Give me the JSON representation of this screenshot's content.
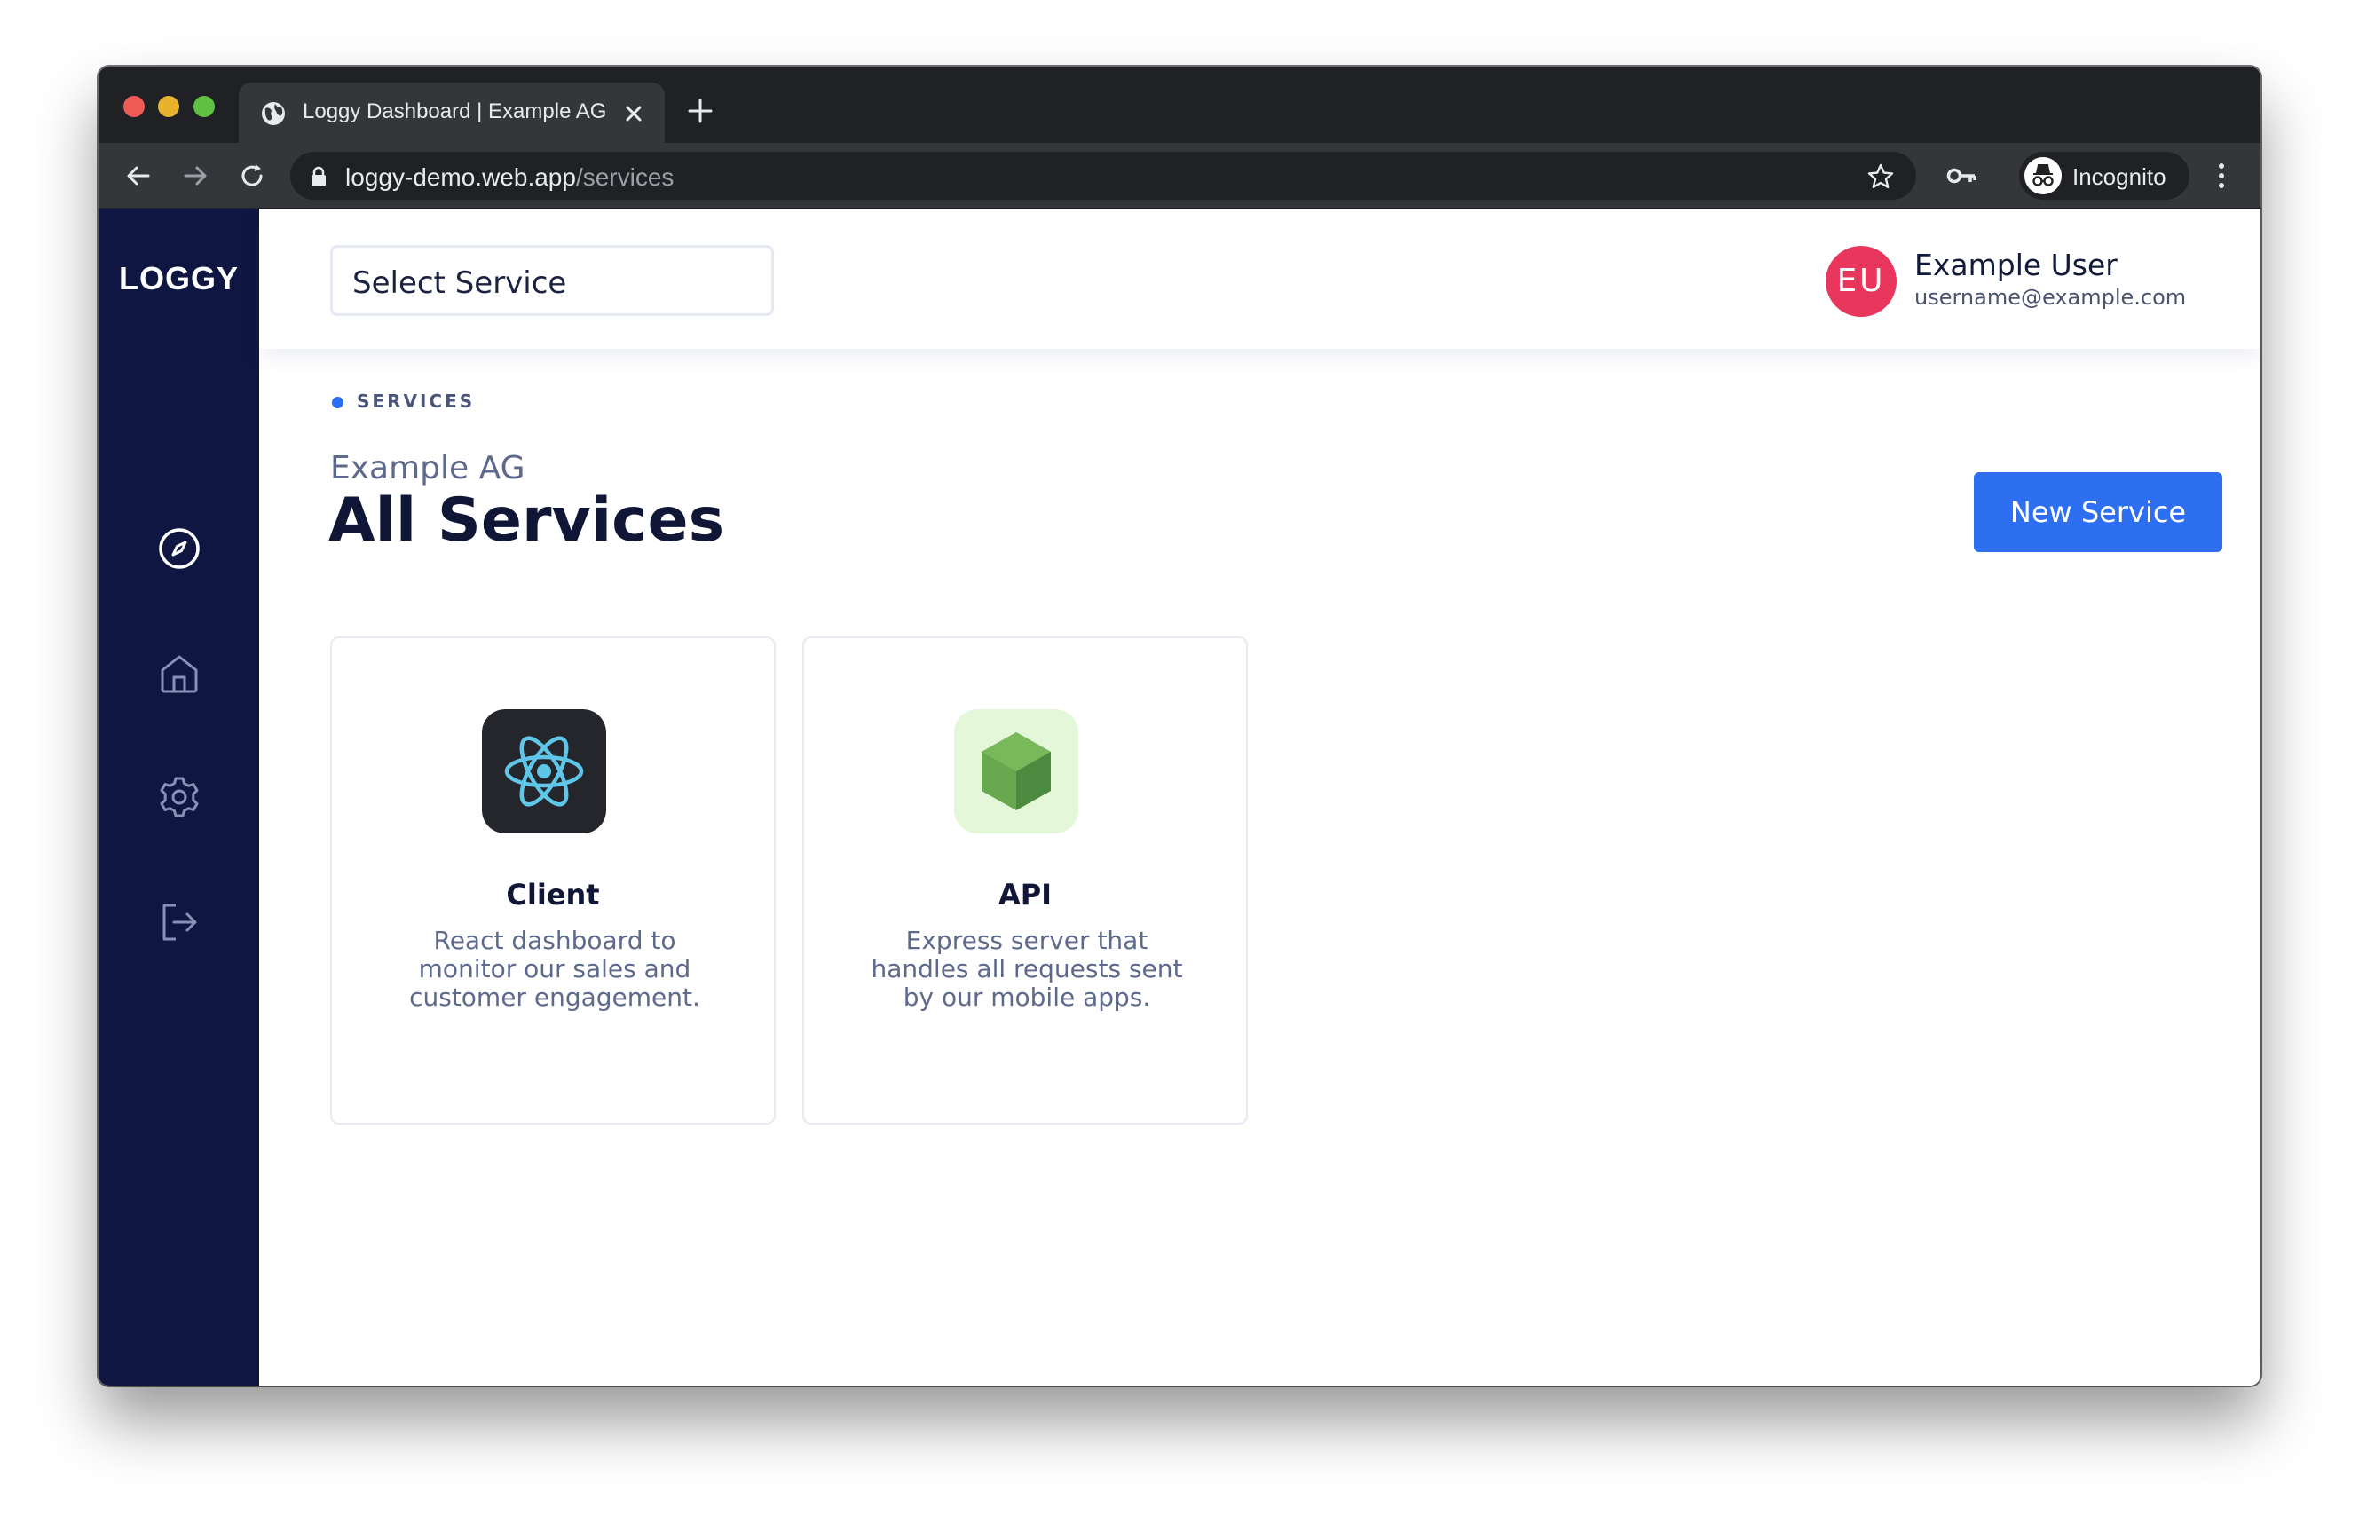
{
  "browser": {
    "tab_title": "Loggy Dashboard | Example AG",
    "url_host": "loggy-demo.web.app",
    "url_path": "/services",
    "profile_label": "Incognito"
  },
  "sidebar": {
    "logo": "LOGGY",
    "items": [
      {
        "icon": "compass-icon"
      },
      {
        "icon": "home-icon"
      },
      {
        "icon": "gear-icon"
      },
      {
        "icon": "logout-icon"
      }
    ]
  },
  "topbar": {
    "service_select_value": "Select Service",
    "user": {
      "initials": "EU",
      "name": "Example User",
      "email": "username@example.com",
      "avatar_color": "#e8365d"
    }
  },
  "page": {
    "breadcrumb": "SERVICES",
    "org_name": "Example AG",
    "title": "All Services",
    "new_service_label": "New Service",
    "accent_color": "#2d6ff0"
  },
  "services": [
    {
      "name": "Client",
      "description": "React dashboard to monitor our sales and customer engagement.",
      "icon": "react-icon"
    },
    {
      "name": "API",
      "description": "Express server that handles all requests sent by our mobile apps.",
      "icon": "nodejs-icon"
    }
  ]
}
